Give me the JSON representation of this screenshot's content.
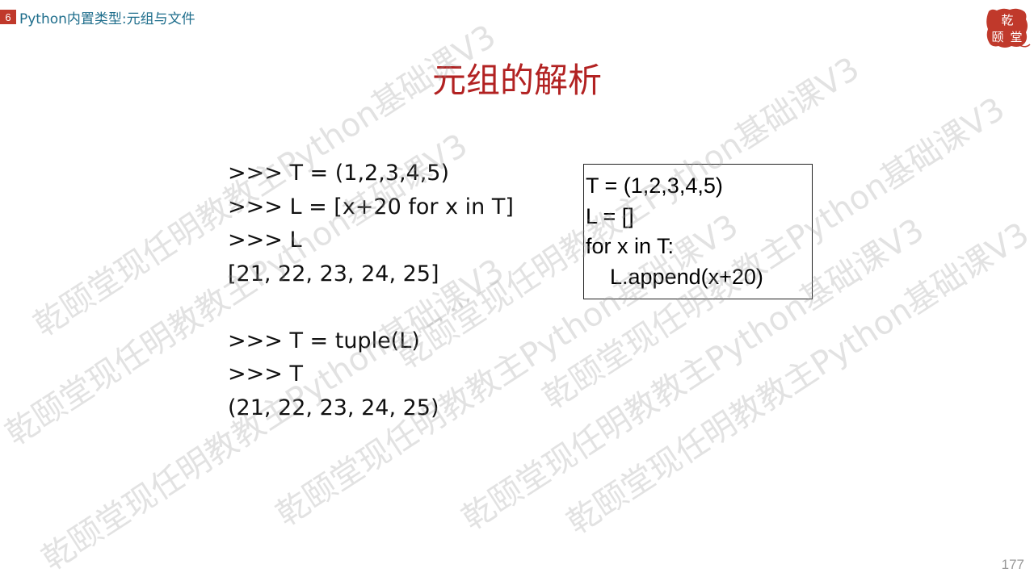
{
  "header": {
    "chapter_number": "6",
    "section_title": "Python内置类型:元组与文件"
  },
  "logo": {
    "chars": [
      "乾",
      "颐",
      "堂"
    ],
    "color": "#c0392b"
  },
  "slide": {
    "title": "元组的解析",
    "left_code_block_1": [
      ">>> T = (1,2,3,4,5)",
      ">>> L = [x+20 for x in T]",
      ">>> L",
      "[21, 22, 23, 24, 25]"
    ],
    "left_code_block_2": [
      ">>> T = tuple(L)",
      ">>> T",
      "(21, 22, 23, 24, 25)"
    ],
    "right_code_box": [
      "T = (1,2,3,4,5)",
      "L = []",
      "for x in T:",
      "    L.append(x+20)"
    ],
    "page_number": "177"
  },
  "watermark": {
    "text": "乾颐堂现任明教教主Python基础课V3",
    "color": "#969696"
  },
  "colors": {
    "title": "#b22222",
    "section": "#1f6e8c",
    "badge": "#c0392b"
  }
}
